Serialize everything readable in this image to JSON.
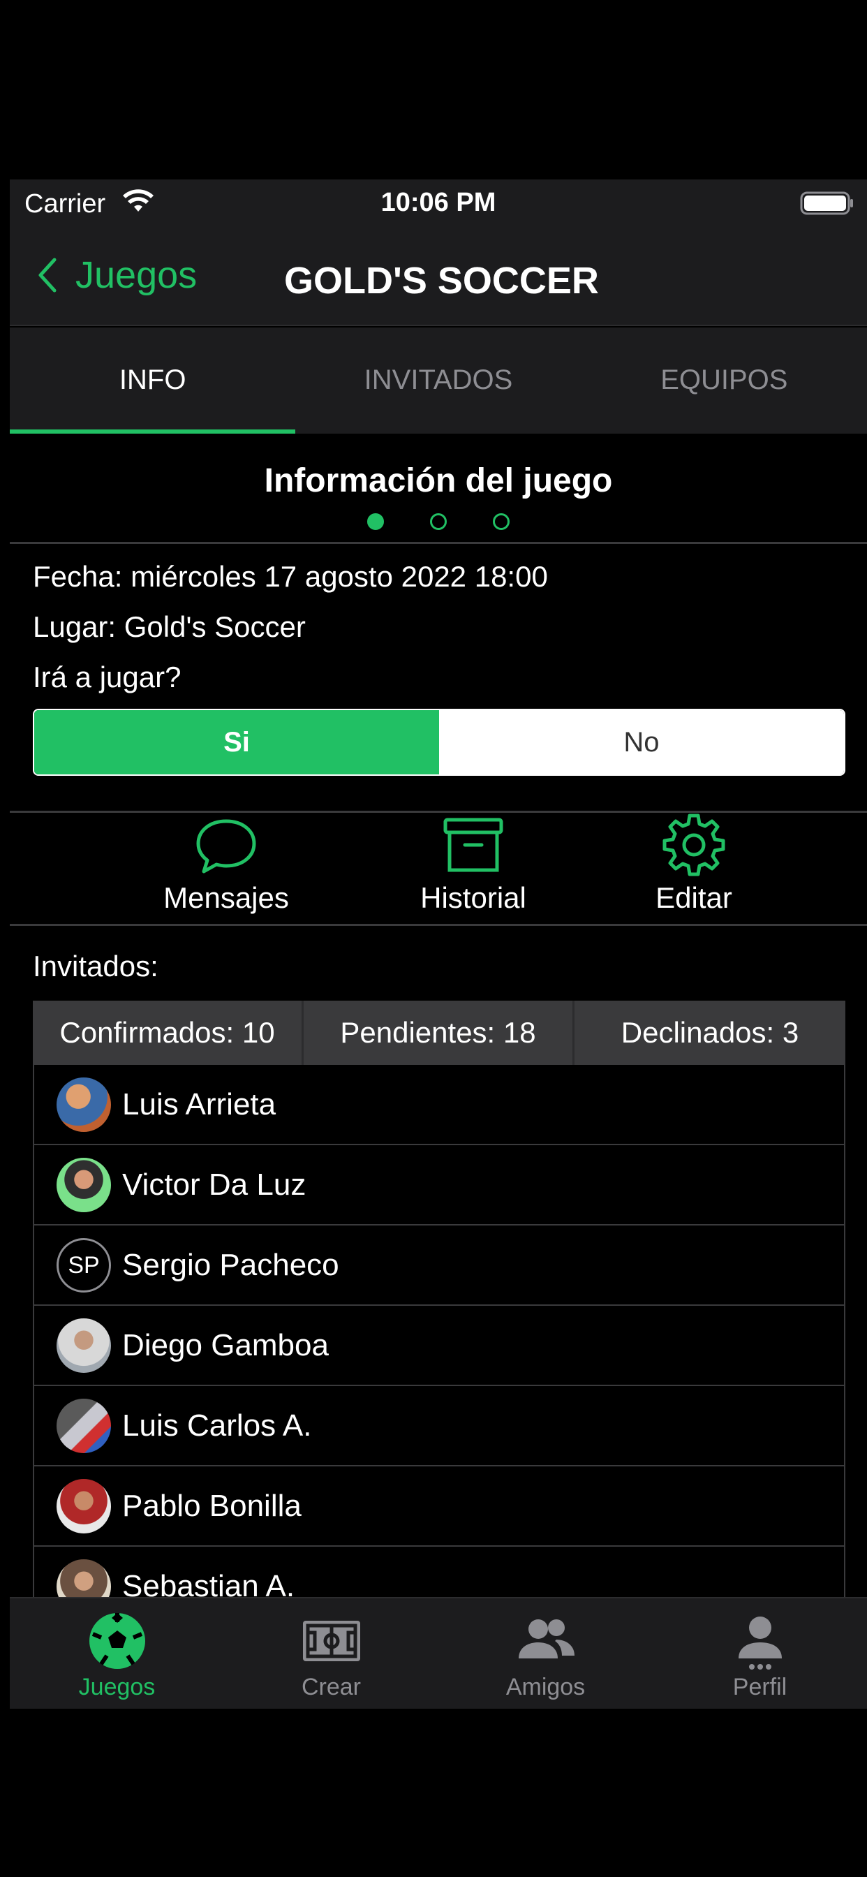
{
  "status_bar": {
    "carrier": "Carrier",
    "time": "10:06 PM"
  },
  "nav": {
    "back_label": "Juegos",
    "title": "GOLD'S SOCCER"
  },
  "tabs": [
    {
      "label": "INFO",
      "active": true
    },
    {
      "label": "INVITADOS",
      "active": false
    },
    {
      "label": "EQUIPOS",
      "active": false
    }
  ],
  "section": {
    "title": "Información del juego",
    "page_dots": 3,
    "current_page": 1
  },
  "info": {
    "fecha": "Fecha: miércoles 17 agosto 2022 18:00",
    "lugar": "Lugar:  Gold's Soccer",
    "question": "Irá a jugar?"
  },
  "attendance": {
    "yes_label": "Si",
    "no_label": "No",
    "selected": "Si"
  },
  "actions": [
    {
      "label": "Mensajes",
      "icon": "chat-bubble-icon"
    },
    {
      "label": "Historial",
      "icon": "archive-box-icon"
    },
    {
      "label": "Editar",
      "icon": "gear-icon"
    }
  ],
  "invitados": {
    "label": "Invitados:",
    "counts": [
      {
        "text": "Confirmados:  10"
      },
      {
        "text": "Pendientes:  18"
      },
      {
        "text": "Declinados:  3"
      }
    ],
    "people": [
      {
        "name": "Luis Arrieta",
        "avatar": "photo"
      },
      {
        "name": "Victor Da Luz",
        "avatar": "photo"
      },
      {
        "name": "Sergio Pacheco",
        "avatar": "initials",
        "initials": "SP"
      },
      {
        "name": "Diego Gamboa",
        "avatar": "photo"
      },
      {
        "name": "Luis Carlos A.",
        "avatar": "photo"
      },
      {
        "name": "Pablo Bonilla",
        "avatar": "photo"
      },
      {
        "name": "Sebastian A.",
        "avatar": "photo"
      }
    ]
  },
  "tab_bar": [
    {
      "label": "Juegos",
      "icon": "soccer-ball-icon",
      "active": true
    },
    {
      "label": "Crear",
      "icon": "soccer-field-icon",
      "active": false
    },
    {
      "label": "Amigos",
      "icon": "people-icon",
      "active": false
    },
    {
      "label": "Perfil",
      "icon": "person-icon",
      "active": false
    }
  ],
  "colors": {
    "accent": "#21c064",
    "background": "#000000",
    "bar": "#1c1c1e"
  }
}
